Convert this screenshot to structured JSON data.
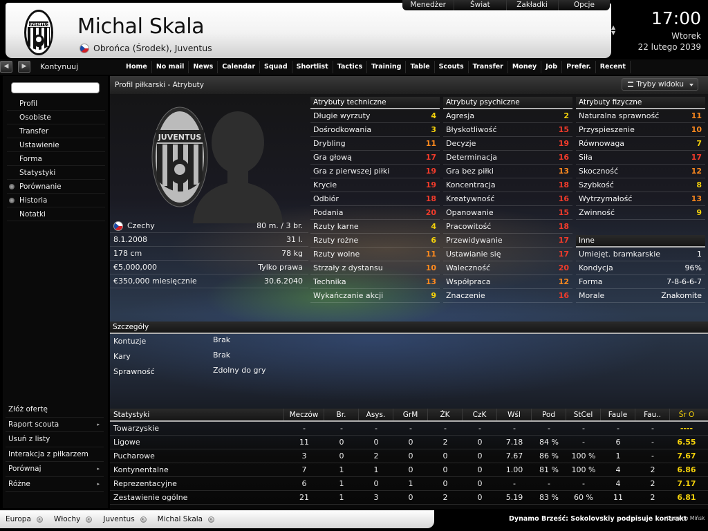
{
  "header": {
    "player_name": "Michal Skala",
    "subtitle": "Obrońca (Środek), Juventus",
    "top_menu": [
      "Menedżer",
      "Świat",
      "Zakładki",
      "Opcje"
    ],
    "time": "17:00",
    "day": "Wtorek",
    "date": "22 lutego 2039"
  },
  "nav": {
    "continue_label": "Kontynuuj",
    "menu": [
      "Home",
      "No mail",
      "News",
      "Calendar",
      "Squad",
      "Shortlist",
      "Tactics",
      "Training",
      "Table",
      "Scouts",
      "Transfer",
      "Money",
      "Job",
      "Prefer.",
      "Recent"
    ]
  },
  "sidebar": {
    "items": [
      {
        "label": "Profil",
        "bullet": false
      },
      {
        "label": "Osobiste",
        "bullet": false
      },
      {
        "label": "Transfer",
        "bullet": false
      },
      {
        "label": "Ustawienie",
        "bullet": false
      },
      {
        "label": "Forma",
        "bullet": false
      },
      {
        "label": "Statystyki",
        "bullet": false
      },
      {
        "label": "Porównanie",
        "bullet": true
      },
      {
        "label": "Historia",
        "bullet": true
      },
      {
        "label": "Notatki",
        "bullet": false
      }
    ],
    "actions": [
      {
        "label": "Złóż ofertę",
        "arrow": false
      },
      {
        "label": "Raport scouta",
        "arrow": true
      },
      {
        "label": "Usuń z listy",
        "arrow": false
      },
      {
        "label": "Interakcja z piłkarzem",
        "arrow": false
      },
      {
        "label": "Porównaj",
        "arrow": true
      },
      {
        "label": "Różne",
        "arrow": true
      }
    ]
  },
  "panel": {
    "title": "Profil piłkarski - Atrybuty",
    "view_mode": "Tryby widoku"
  },
  "bio": [
    {
      "label": "Czechy",
      "value": "80 m. / 3 br.",
      "flag": true
    },
    {
      "label": "8.1.2008",
      "value": "31 l."
    },
    {
      "label": "178 cm",
      "value": "78 kg"
    },
    {
      "label": "€5,000,000",
      "value": "Tylko prawa"
    },
    {
      "label": "€350,000 miesięcznie",
      "value": "30.6.2040"
    }
  ],
  "technical": {
    "header": "Atrybuty techniczne",
    "rows": [
      {
        "label": "Długie wyrzuty",
        "value": "4",
        "color": "y"
      },
      {
        "label": "Dośrodkowania",
        "value": "3",
        "color": "y"
      },
      {
        "label": "Drybling",
        "value": "11",
        "color": "o"
      },
      {
        "label": "Gra głową",
        "value": "17",
        "color": "r"
      },
      {
        "label": "Gra z pierwszej piłki",
        "value": "19",
        "color": "r"
      },
      {
        "label": "Krycie",
        "value": "19",
        "color": "r"
      },
      {
        "label": "Odbiór",
        "value": "18",
        "color": "r"
      },
      {
        "label": "Podania",
        "value": "20",
        "color": "r"
      },
      {
        "label": "Rzuty karne",
        "value": "4",
        "color": "y"
      },
      {
        "label": "Rzuty rożne",
        "value": "6",
        "color": "y"
      },
      {
        "label": "Rzuty wolne",
        "value": "11",
        "color": "o"
      },
      {
        "label": "Strzały z dystansu",
        "value": "10",
        "color": "o"
      },
      {
        "label": "Technika",
        "value": "13",
        "color": "o"
      },
      {
        "label": "Wykańczanie akcji",
        "value": "9",
        "color": "y"
      }
    ]
  },
  "mental": {
    "header": "Atrybuty psychiczne",
    "rows": [
      {
        "label": "Agresja",
        "value": "2",
        "color": "y"
      },
      {
        "label": "Błyskotliwość",
        "value": "15",
        "color": "r"
      },
      {
        "label": "Decyzje",
        "value": "19",
        "color": "r"
      },
      {
        "label": "Determinacja",
        "value": "16",
        "color": "r"
      },
      {
        "label": "Gra bez piłki",
        "value": "13",
        "color": "o"
      },
      {
        "label": "Koncentracja",
        "value": "18",
        "color": "r"
      },
      {
        "label": "Kreatywność",
        "value": "16",
        "color": "r"
      },
      {
        "label": "Opanowanie",
        "value": "15",
        "color": "r"
      },
      {
        "label": "Pracowitość",
        "value": "18",
        "color": "r"
      },
      {
        "label": "Przewidywanie",
        "value": "17",
        "color": "r"
      },
      {
        "label": "Ustawianie się",
        "value": "17",
        "color": "r"
      },
      {
        "label": "Waleczność",
        "value": "20",
        "color": "r"
      },
      {
        "label": "Współpraca",
        "value": "12",
        "color": "o"
      },
      {
        "label": "Znaczenie",
        "value": "16",
        "color": "r"
      }
    ]
  },
  "physical": {
    "header": "Atrybuty fizyczne",
    "rows": [
      {
        "label": "Naturalna sprawność",
        "value": "11",
        "color": "o"
      },
      {
        "label": "Przyspieszenie",
        "value": "10",
        "color": "o"
      },
      {
        "label": "Równowaga",
        "value": "7",
        "color": "y"
      },
      {
        "label": "Siła",
        "value": "17",
        "color": "r"
      },
      {
        "label": "Skoczność",
        "value": "12",
        "color": "o"
      },
      {
        "label": "Szybkość",
        "value": "8",
        "color": "y"
      },
      {
        "label": "Wytrzymałość",
        "value": "13",
        "color": "o"
      },
      {
        "label": "Zwinność",
        "value": "9",
        "color": "y"
      }
    ]
  },
  "other": {
    "header": "Inne",
    "rows": [
      {
        "label": "Umiejęt. bramkarskie",
        "value": "1"
      },
      {
        "label": "Kondycja",
        "value": "96%"
      },
      {
        "label": "Forma",
        "value": "7-8-6-6-7"
      },
      {
        "label": "Morale",
        "value": "Znakomite"
      }
    ]
  },
  "details": {
    "header": "Szczegóły",
    "rows": [
      {
        "label": "Kontuzje",
        "value": "Brak"
      },
      {
        "label": "Kary",
        "value": "Brak"
      },
      {
        "label": "Sprawność",
        "value": "Zdolny do gry"
      }
    ]
  },
  "stats": {
    "headers": [
      "Statystyki",
      "Meczów",
      "Br.",
      "Asys.",
      "GrM",
      "ŻK",
      "CzK",
      "Wśl",
      "Pod",
      "StCel",
      "Faule",
      "Fau..",
      "Śr O"
    ],
    "rows": [
      [
        "Towarzyskie",
        "-",
        "-",
        "-",
        "-",
        "-",
        "-",
        "-",
        "-",
        "-",
        "-",
        "-",
        "----"
      ],
      [
        "Ligowe",
        "11",
        "0",
        "0",
        "0",
        "2",
        "0",
        "7.18",
        "84 %",
        "-",
        "6",
        "-",
        "6.55"
      ],
      [
        "Pucharowe",
        "3",
        "0",
        "2",
        "0",
        "0",
        "0",
        "7.67",
        "86 %",
        "100 %",
        "1",
        "-",
        "7.67"
      ],
      [
        "Kontynentalne",
        "7",
        "1",
        "1",
        "0",
        "0",
        "0",
        "1.00",
        "81 %",
        "100 %",
        "4",
        "2",
        "6.86"
      ],
      [
        "Reprezentacyjne",
        "6",
        "1",
        "0",
        "1",
        "0",
        "0",
        "-",
        "-",
        "-",
        "4",
        "2",
        "7.17"
      ],
      [
        "Zestawienie ogólne",
        "21",
        "1",
        "3",
        "0",
        "2",
        "0",
        "5.19",
        "83 %",
        "60 %",
        "11",
        "2",
        "6.81"
      ]
    ]
  },
  "breadcrumb": [
    "Europa",
    "Włochy",
    "Juventus",
    "Michal Skala"
  ],
  "news_ticker": "Dynamo Brześć: Sokolovskiy podpisuje kontrakt",
  "news_ticker_2": "Dynamo Mińsk",
  "colors": {
    "y": "#f4d10b",
    "o": "#ff8a1e",
    "r": "#f23b2b"
  }
}
